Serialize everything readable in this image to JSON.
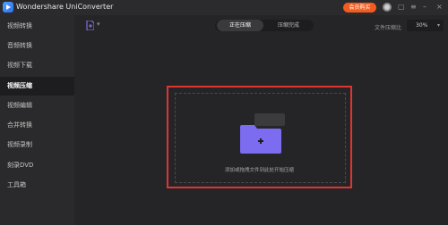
{
  "window": {
    "title": "Wondershare UniConverter",
    "member_button": "会员购买",
    "icons": [
      "logo-icon",
      "avatar-icon",
      "gift-icon",
      "menu-icon",
      "minimize-icon",
      "close-icon"
    ]
  },
  "sidebar": {
    "items": [
      {
        "label": "视频转换"
      },
      {
        "label": "音频转换"
      },
      {
        "label": "视频下载"
      },
      {
        "label": "视频压缩"
      },
      {
        "label": "视频编辑"
      },
      {
        "label": "合并转换"
      },
      {
        "label": "视频录制"
      },
      {
        "label": "刻录DVD"
      },
      {
        "label": "工具箱"
      }
    ],
    "active_index": 3
  },
  "toolbar": {
    "tabs": [
      {
        "label": "正在压缩"
      },
      {
        "label": "压缩完成"
      }
    ],
    "active_tab": 0,
    "ratio_label": "文件压缩比",
    "ratio_value": "30%"
  },
  "dropzone": {
    "hint": "添加或拖拽文件到此处开始压缩"
  },
  "colors": {
    "accent_orange": "#f25c1f",
    "highlight_red": "#e0342f",
    "folder_purple": "#7b6cf0",
    "background": "#252527",
    "sidebar": "#2a2a2c"
  }
}
